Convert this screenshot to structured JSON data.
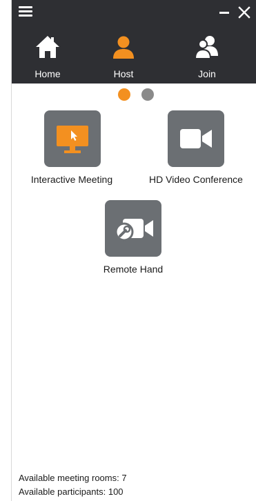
{
  "window": {
    "titlebar": {
      "menu_icon": "hamburger-icon",
      "minimize_icon": "minimize-icon",
      "close_icon": "close-icon"
    }
  },
  "nav": {
    "items": [
      {
        "label": "Home",
        "icon": "home-icon",
        "active": false
      },
      {
        "label": "Host",
        "icon": "user-icon",
        "active": true
      },
      {
        "label": "Join",
        "icon": "users-icon",
        "active": false
      }
    ]
  },
  "pager": {
    "count": 2,
    "active_index": 0
  },
  "tiles": [
    {
      "label": "Interactive Meeting",
      "icon": "monitor-cursor-icon",
      "color": "#f39020"
    },
    {
      "label": "HD Video Conference",
      "icon": "video-camera-icon",
      "color": "#ffffff"
    },
    {
      "label": "Remote Hand",
      "icon": "video-camera-wrench-icon",
      "color": "#ffffff"
    }
  ],
  "status": {
    "rooms": "Available meeting rooms: 7",
    "participants": "Available participants: 100"
  },
  "colors": {
    "dark_bar": "#2e2f33",
    "accent_orange": "#f39020",
    "tile_gray": "#6b6f73",
    "dot_gray": "#8a8a8a"
  }
}
